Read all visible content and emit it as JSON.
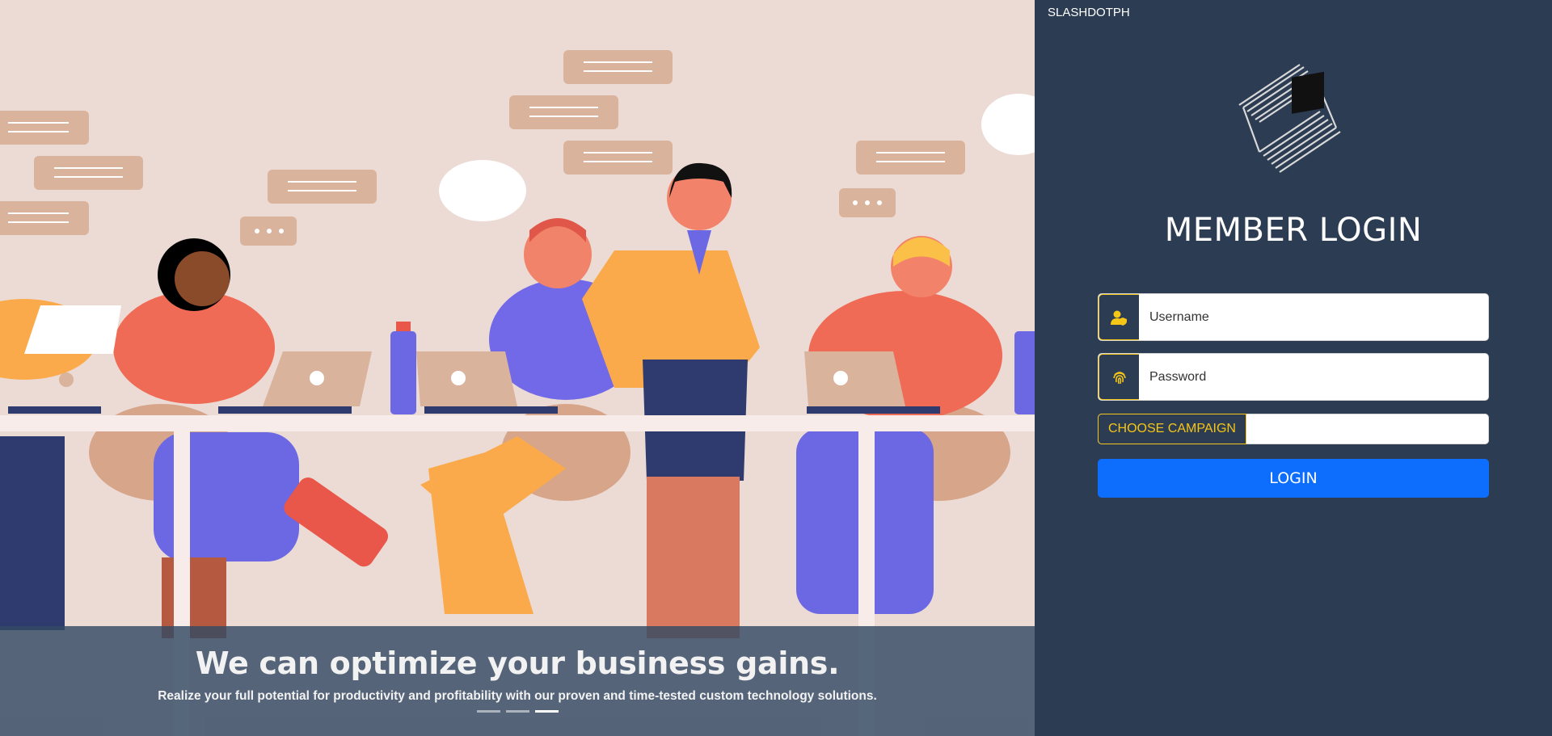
{
  "hero": {
    "headline": "We can optimize your business gains.",
    "subtext": "Realize your full potential for productivity and profitability with our proven and time-tested custom technology solutions.",
    "indicators": [
      {
        "active": false
      },
      {
        "active": false
      },
      {
        "active": true
      }
    ]
  },
  "panel": {
    "brand": "SLASHDOTPH",
    "title": "MEMBER LOGIN",
    "username_placeholder": "Username",
    "password_placeholder": "Password",
    "campaign_label": "CHOOSE CAMPAIGN",
    "campaign_value": "",
    "login_label": "LOGIN"
  },
  "colors": {
    "panel_bg": "#2c3c52",
    "accent": "#f5c518",
    "primary_button": "#0d6efd",
    "hero_bg": "#ecdbd5"
  },
  "icons": {
    "username": "user-shield-icon",
    "password": "fingerprint-icon"
  }
}
